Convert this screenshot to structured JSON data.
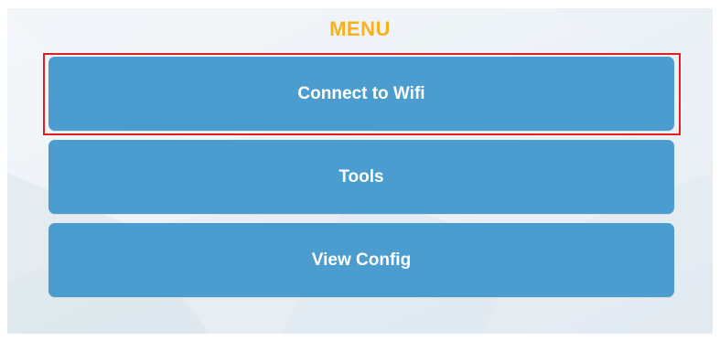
{
  "menu": {
    "title": "MENU",
    "buttons": [
      {
        "label": "Connect to Wifi"
      },
      {
        "label": "Tools"
      },
      {
        "label": "View Config"
      }
    ]
  },
  "colors": {
    "title": "#f7b11f",
    "button_bg": "#4a9dce",
    "button_text": "#ffffff",
    "highlight_border": "#e02020"
  }
}
